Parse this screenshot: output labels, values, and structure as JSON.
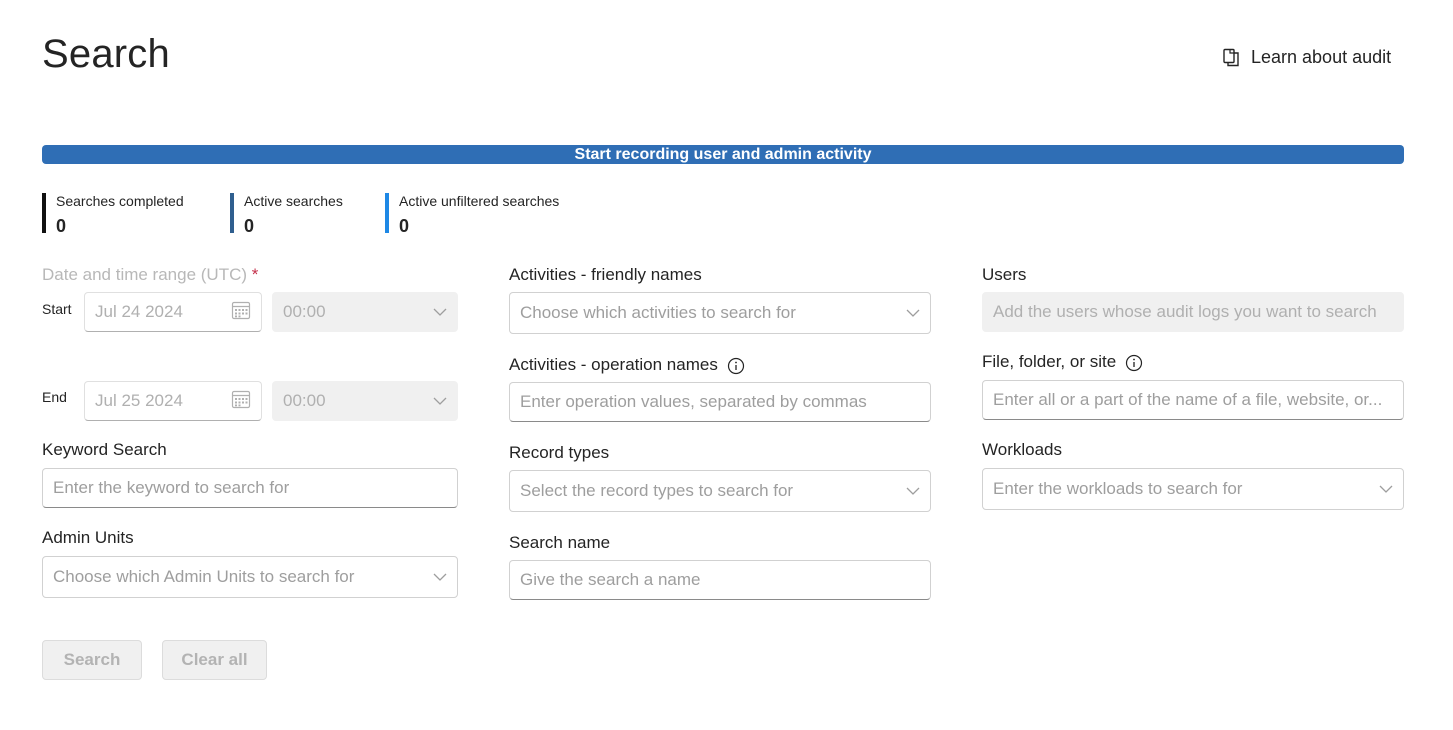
{
  "header": {
    "title": "Search",
    "learn_link": "Learn about audit",
    "learn_icon": "copy-pages-icon"
  },
  "banner": {
    "label": "Start recording user and admin activity",
    "color": "#2f6eb5"
  },
  "stats": [
    {
      "label": "Searches completed",
      "value": "0"
    },
    {
      "label": "Active searches",
      "value": "0"
    },
    {
      "label": "Active unfiltered searches",
      "value": "0"
    }
  ],
  "date_range": {
    "label": "Date and time range (UTC)",
    "required_mark": "*",
    "start_label": "Start",
    "start_date": "Jul 24 2024",
    "start_time": "00:00",
    "end_label": "End",
    "end_date": "Jul 25 2024",
    "end_time": "00:00"
  },
  "keyword": {
    "label": "Keyword Search",
    "placeholder": "Enter the keyword to search for"
  },
  "admin_units": {
    "label": "Admin Units",
    "placeholder": "Choose which Admin Units to search for"
  },
  "activities_friendly": {
    "label": "Activities - friendly names",
    "placeholder": "Choose which activities to search for"
  },
  "activities_operation": {
    "label": "Activities - operation names",
    "placeholder": "Enter operation values, separated by commas"
  },
  "record_types": {
    "label": "Record types",
    "placeholder": "Select the record types to search for"
  },
  "search_name": {
    "label": "Search name",
    "placeholder": "Give the search a name"
  },
  "users": {
    "label": "Users",
    "placeholder": "Add the users whose audit logs you want to search"
  },
  "file_folder_site": {
    "label": "File, folder, or site",
    "placeholder": "Enter all or a part of the name of a file, website, or..."
  },
  "workloads": {
    "label": "Workloads",
    "placeholder": "Enter the workloads to search for"
  },
  "buttons": {
    "search": "Search",
    "clear_all": "Clear all"
  }
}
